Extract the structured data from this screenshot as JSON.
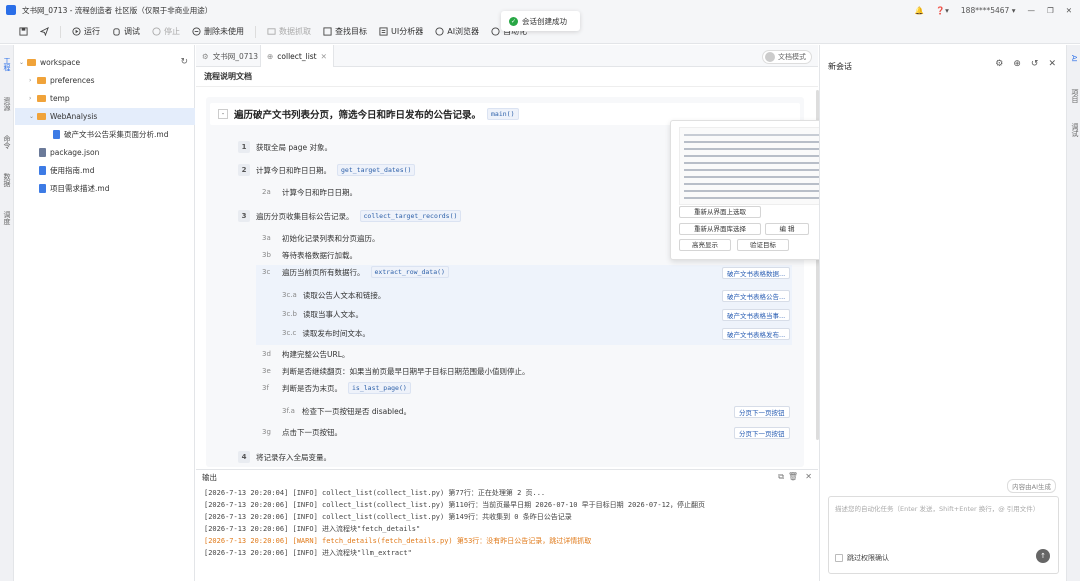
{
  "window": {
    "title": "文书网_0713 - 流程创造者 社区版（仅限于非商业用途）",
    "user": "188****5467 ▾",
    "bell": "🔔",
    "help": "❓▾",
    "minimize": "—",
    "restore": "❐",
    "close": "✕"
  },
  "toolbar": {
    "run": "运行",
    "debug": "调试",
    "stop": "停止",
    "delete_unused": "删除未使用",
    "data_capture": "数据抓取",
    "find_target": "查找目标",
    "ui_analyzer": "UI分析器",
    "ai_browser": "AI浏览器",
    "more": "自动化"
  },
  "toast": {
    "text": "会话创建成功",
    "icon": "✓"
  },
  "activity": {
    "items": [
      "工程",
      "资源",
      "命令",
      "数据",
      "调度"
    ]
  },
  "right_strip": {
    "items": [
      "AI",
      "项目",
      "调试"
    ]
  },
  "tree": {
    "refresh": "↻",
    "items": [
      {
        "label": "workspace",
        "type": "folder",
        "indent": 0,
        "chev": "⌄"
      },
      {
        "label": "preferences",
        "type": "folder",
        "indent": 1,
        "chev": "›"
      },
      {
        "label": "temp",
        "type": "folder",
        "indent": 1,
        "chev": "›"
      },
      {
        "label": "WebAnalysis",
        "type": "folder",
        "indent": 1,
        "chev": "⌄",
        "selected": true
      },
      {
        "label": "破产文书公告采集页面分析.md",
        "type": "file",
        "indent": 2
      },
      {
        "label": "package.json",
        "type": "json",
        "indent": 1
      },
      {
        "label": "使用指南.md",
        "type": "file",
        "indent": 1
      },
      {
        "label": "项目需求描述.md",
        "type": "file",
        "indent": 1
      }
    ]
  },
  "tabs": [
    {
      "label": "文书网_0713 ●"
    },
    {
      "label": "collect_list",
      "close": "✕",
      "active": true
    }
  ],
  "doc_mode": "文档模式",
  "doc": {
    "heading": "流程说明文档",
    "collapse": "-",
    "main_title": "遍历破产文书列表分页，筛选今日和昨日发布的公告记录。",
    "main_code": "main()",
    "steps": [
      {
        "n": "1",
        "text": "获取全局 page 对象。"
      },
      {
        "n": "2",
        "text": "计算今日和昨日日期。",
        "code": "get_target_dates()"
      },
      {
        "sub": "2a",
        "text": "计算今日和昨日日期。"
      },
      {
        "n": "3",
        "text": "遍历分页收集目标公告记录。",
        "code": "collect_target_records()"
      },
      {
        "sub": "3a",
        "text": "初始化记录列表和分页遍历。"
      },
      {
        "sub": "3b",
        "text": "等待表格数据行加载。"
      },
      {
        "sub": "3c",
        "text": "遍历当前页所有数据行。",
        "code": "extract_row_data()",
        "target": "破产文书表格数据..."
      },
      {
        "sub": "3c.a",
        "text": "读取公告人文本和链接。",
        "target": "破产文书表格公告..."
      },
      {
        "sub": "3c.b",
        "text": "读取当事人文本。",
        "target": "破产文书表格当事..."
      },
      {
        "sub": "3c.c",
        "text": "读取发布时间文本。",
        "target": "破产文书表格发布..."
      },
      {
        "sub": "3d",
        "text": "构建完整公告URL。"
      },
      {
        "sub": "3e",
        "text": "判断是否继续翻页：如果当前页最早日期早于目标日期范围最小值则停止。"
      },
      {
        "sub": "3f",
        "text": "判断是否为末页。",
        "code": "is_last_page()"
      },
      {
        "sub": "3f.a",
        "text": "检查下一页按钮是否 disabled。",
        "target": "分页下一页按钮"
      },
      {
        "sub": "3g",
        "text": "点击下一页按钮。",
        "target": "分页下一页按钮"
      },
      {
        "n": "4",
        "text": "将记录存入全局变量。"
      }
    ]
  },
  "popup": {
    "btn_reselect": "重新从界面上选取",
    "btn_reselect_lib": "重新从界面库选择",
    "btn_edit": "编 辑",
    "btn_highlight": "高亮显示",
    "btn_verify": "验证目标"
  },
  "output": {
    "title": "输出",
    "lines": [
      {
        "text": "[2026-7-13 20:20:04] [INFO] collect_list(collect_list.py) 第77行：正在处理第 2 页...",
        "level": "info"
      },
      {
        "text": "[2026-7-13 20:20:06] [INFO] collect_list(collect_list.py) 第110行：当前页最早日期 2026-07-10 早于目标日期 2026-07-12，停止翻页",
        "level": "info"
      },
      {
        "text": "[2026-7-13 20:20:06] [INFO] collect_list(collect_list.py) 第149行：共收集到 0 条昨日公告记录",
        "level": "info"
      },
      {
        "text": "[2026-7-13 20:20:06] [INFO] 进入流程块\"fetch_details\"",
        "level": "info"
      },
      {
        "text": "[2026-7-13 20:20:06] [WARN] fetch_details(fetch_details.py) 第53行：没有昨日公告记录，跳过详情抓取",
        "level": "warn"
      },
      {
        "text": "[2026-7-13 20:20:06] [INFO] 进入流程块\"llm_extract\"",
        "level": "info"
      }
    ]
  },
  "chat": {
    "title": "新会话",
    "badge": "内容由AI生成",
    "placeholder": "描述您的自动化任务（Enter 发送，Shift+Enter 换行，@ 引用文件）",
    "checkbox": "跳过权限确认",
    "send": "↑"
  }
}
